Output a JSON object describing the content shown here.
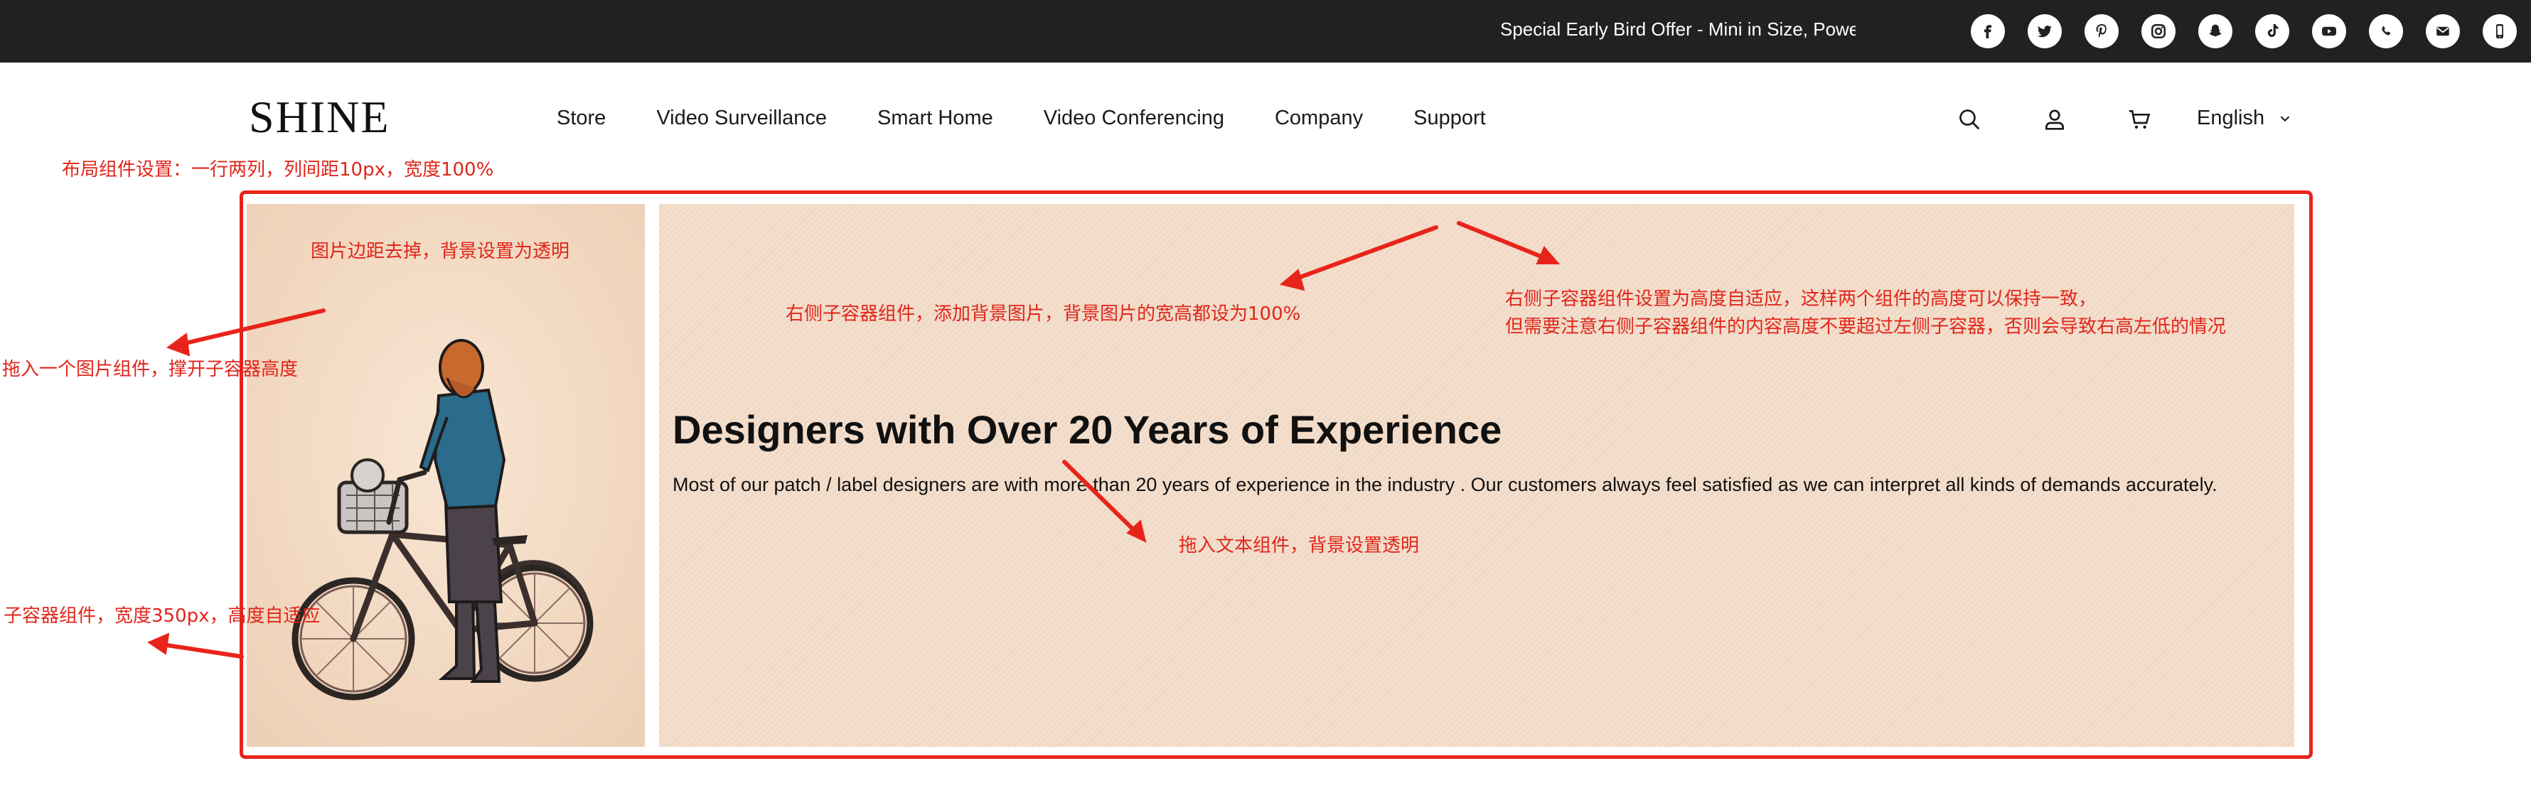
{
  "topbar": {
    "announcement": "Special Early Bird Offer - Mini in Size, Powerfu",
    "social_icons": [
      "facebook-icon",
      "twitter-icon",
      "pinterest-icon",
      "instagram-icon",
      "snapchat-icon",
      "tiktok-icon",
      "youtube-icon",
      "whatsapp-icon",
      "email-icon",
      "phone-icon"
    ]
  },
  "header": {
    "logo": "SHINE",
    "nav": [
      "Store",
      "Video Surveillance",
      "Smart Home",
      "Video Conferencing",
      "Company",
      "Support"
    ],
    "icons": [
      "search-icon",
      "account-icon",
      "cart-icon"
    ],
    "language": "English"
  },
  "content": {
    "heading": "Designers with Over 20 Years of Experience",
    "paragraph": "Most of our patch / label designers are with more than 20 years of experience in the industry . Our customers always feel satisfied as we can interpret all kinds of demands accurately."
  },
  "annotations": {
    "layout": "布局组件设置：一行两列，列间距10px，宽度100%",
    "image_margin": "图片边距去掉，背景设置为透明",
    "right_bg": "右侧子容器组件，添加背景图片，背景图片的宽高都设为100%",
    "right_height_1": "右侧子容器组件设置为高度自适应，这样两个组件的高度可以保持一致，",
    "right_height_2": "但需要注意右侧子容器组件的内容高度不要超过左侧子容器，否则会导致右高左低的情况",
    "drag_image": "拖入一个图片组件，撑开子容器高度",
    "left_container": "子容器组件，宽度350px，高度自适应",
    "drag_text": "拖入文本组件，背景设置透明"
  },
  "colors": {
    "topbar": "#212121",
    "annotation": "#e0261b",
    "panel_bg": "#f4dcc8"
  }
}
